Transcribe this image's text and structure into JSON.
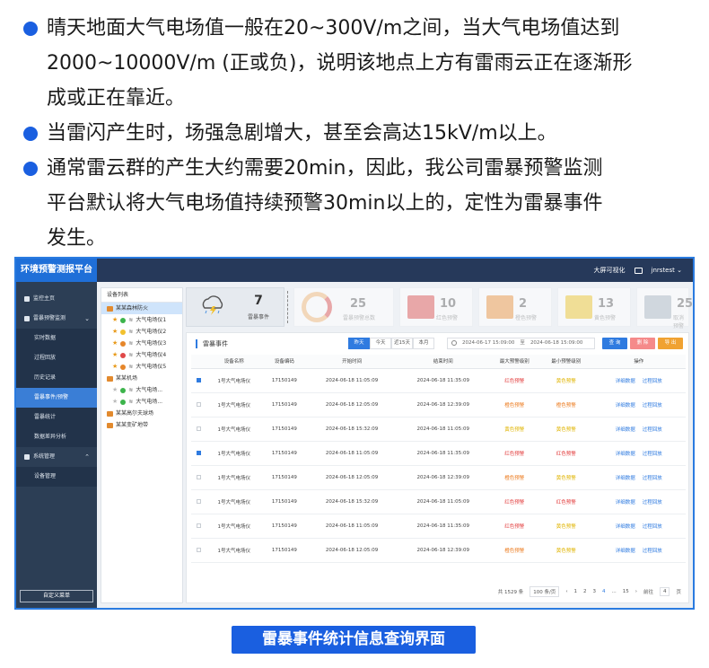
{
  "bullets": [
    {
      "lines": [
        "晴天地面大气电场值一般在20~300V/m之间，当大气电场值达到",
        "2000~10000V/m (正或负)，说明该地点上方有雷雨云正在逐渐形",
        "成或正在靠近。"
      ]
    },
    {
      "lines": [
        "当雷闪产生时，场强急剧增大，甚至会高达15kV/m以上。"
      ]
    },
    {
      "lines": [
        "通常雷云群的产生大约需要20min，因此，我公司雷暴预警监测",
        "平台默认将大气电场值持续预警30min以上的，定性为雷暴事件",
        "发生。"
      ]
    }
  ],
  "app": {
    "title": "环境预警测报平台",
    "top_right": {
      "big_screen": "大屏可视化",
      "user": "jnrstest"
    },
    "sidebar": {
      "menus": [
        {
          "label": "监控主页",
          "chevron": ""
        },
        {
          "label": "雷暴预警监测",
          "chevron": "⌄"
        }
      ],
      "sub_items": [
        "实时数据",
        "过程回放",
        "历史记录",
        "雷暴事件/预警",
        "雷暴统计",
        "数据差异分析"
      ],
      "active_sub": "雷暴事件/预警",
      "menu2": {
        "label": "系统管理",
        "chevron": "⌃"
      },
      "menu2_sub": [
        "设备管理"
      ],
      "custom": "自定义菜单"
    },
    "device_panel": {
      "header": "设备列表",
      "groups": [
        {
          "name": "某某森林防火",
          "selected": true,
          "children": [
            {
              "name": "大气电场仪1",
              "star": true,
              "lamp": "#3cb44b"
            },
            {
              "name": "大气电场仪2",
              "star": true,
              "lamp": "#f2c12e"
            },
            {
              "name": "大气电场仪3",
              "star": true,
              "lamp": "#e6862a"
            },
            {
              "name": "大气电场仪4",
              "star": true,
              "lamp": "#e04848"
            },
            {
              "name": "大气电场仪5",
              "star": true,
              "lamp": "#e6862a"
            }
          ]
        },
        {
          "name": "某某机场",
          "selected": false,
          "children": [
            {
              "name": "大气电场...",
              "star": false,
              "lamp": "#3cb44b"
            },
            {
              "name": "大气电场...",
              "star": false,
              "lamp": "#3cb44b"
            }
          ]
        },
        {
          "name": "某某高尔夫球场",
          "selected": false,
          "children": []
        },
        {
          "name": "某某变矿地带",
          "selected": false,
          "children": []
        }
      ]
    },
    "stats": {
      "storm_count": "7",
      "storm_label": "雷暴事件",
      "faded": [
        {
          "num": "25",
          "label": "雷暴预警总数",
          "color": "#f7c38a"
        },
        {
          "num": "10",
          "label": "红色预警",
          "color": "#e46b6b"
        },
        {
          "num": "2",
          "label": "橙色预警",
          "color": "#f0a35a"
        },
        {
          "num": "13",
          "label": "黄色预警",
          "color": "#f2cf4a"
        },
        {
          "num": "25",
          "label": "取消预警",
          "color": "#b8c2cc"
        }
      ]
    },
    "panel": {
      "title": "雷暴事件",
      "filters": [
        "昨天",
        "今天",
        "近15天",
        "本月"
      ],
      "active_filter": "昨天",
      "date_start": "2024-06-17 15:09:00",
      "date_sep": "至",
      "date_end": "2024-06-18 15:09:00",
      "actions": [
        {
          "label": "查 询",
          "color": "#2f7be0"
        },
        {
          "label": "删 除",
          "color": "#f58a8a"
        },
        {
          "label": "导 出",
          "color": "#f0a232"
        }
      ],
      "columns": [
        "设备名称",
        "设备编码",
        "开始时间",
        "结束时间",
        "最大预警级别",
        "最小预警级别",
        "操作"
      ],
      "ops": [
        "详细数据",
        "过程回放"
      ],
      "rows": [
        {
          "checked": true,
          "name": "1号大气电场仪",
          "code": "17150149",
          "start": "2024-06-18 11:05:09",
          "end": "2024-06-18 11:35:09",
          "max": "红色预警",
          "max_color": "#e23b3b",
          "min": "黄色预警",
          "min_color": "#e0b400"
        },
        {
          "checked": false,
          "name": "1号大气电场仪",
          "code": "17150149",
          "start": "2024-06-18 12:05:09",
          "end": "2024-06-18 12:39:09",
          "max": "橙色预警",
          "max_color": "#ec7a1d",
          "min": "橙色预警",
          "min_color": "#ec7a1d"
        },
        {
          "checked": false,
          "name": "1号大气电场仪",
          "code": "17150149",
          "start": "2024-06-18 15:32:09",
          "end": "2024-06-18 11:05:09",
          "max": "黄色预警",
          "max_color": "#e0b400",
          "min": "黄色预警",
          "min_color": "#e0b400"
        },
        {
          "checked": true,
          "name": "1号大气电场仪",
          "code": "17150149",
          "start": "2024-06-18 11:05:09",
          "end": "2024-06-18 11:35:09",
          "max": "红色预警",
          "max_color": "#e23b3b",
          "min": "红色预警",
          "min_color": "#e23b3b"
        },
        {
          "checked": false,
          "name": "1号大气电场仪",
          "code": "17150149",
          "start": "2024-06-18 12:05:09",
          "end": "2024-06-18 12:39:09",
          "max": "橙色预警",
          "max_color": "#ec7a1d",
          "min": "黄色预警",
          "min_color": "#e0b400"
        },
        {
          "checked": false,
          "name": "1号大气电场仪",
          "code": "17150149",
          "start": "2024-06-18 15:32:09",
          "end": "2024-06-18 11:05:09",
          "max": "红色预警",
          "max_color": "#e23b3b",
          "min": "红色预警",
          "min_color": "#e23b3b"
        },
        {
          "checked": false,
          "name": "1号大气电场仪",
          "code": "17150149",
          "start": "2024-06-18 11:05:09",
          "end": "2024-06-18 11:35:09",
          "max": "红色预警",
          "max_color": "#e23b3b",
          "min": "黄色预警",
          "min_color": "#e0b400"
        },
        {
          "checked": false,
          "name": "1号大气电场仪",
          "code": "17150149",
          "start": "2024-06-18 12:05:09",
          "end": "2024-06-18 12:39:09",
          "max": "橙色预警",
          "max_color": "#ec7a1d",
          "min": "黄色预警",
          "min_color": "#e0b400"
        }
      ],
      "pager": {
        "total": "共 1529 条",
        "page_size": "100 条/页",
        "pages": [
          "1",
          "2",
          "3",
          "4",
          "...",
          "15"
        ],
        "current": "4",
        "jump_label": "前往",
        "jump_value": "4",
        "jump_unit": "页"
      }
    }
  },
  "caption": "雷暴事件统计信息查询界面"
}
